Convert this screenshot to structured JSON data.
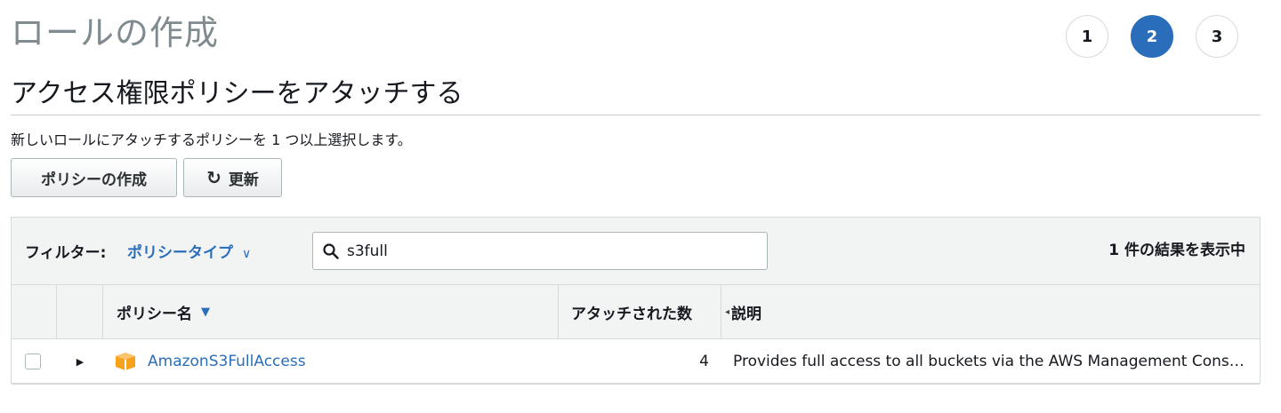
{
  "page": {
    "title": "ロールの作成",
    "steps": [
      "1",
      "2",
      "3"
    ],
    "active_step": "2"
  },
  "section": {
    "title": "アクセス権限ポリシーをアタッチする",
    "description": "新しいロールにアタッチするポリシーを 1 つ以上選択します。"
  },
  "toolbar": {
    "create_policy_label": "ポリシーの作成",
    "refresh_label": "更新",
    "refresh_icon": "refresh-icon"
  },
  "filter": {
    "label": "フィルター:",
    "type_value": "ポリシータイプ",
    "search_value": "s3full",
    "result_count": "1 件の結果を表示中"
  },
  "table": {
    "columns": {
      "name": "ポリシー名",
      "attached": "アタッチされた数",
      "description": "説明"
    },
    "rows": [
      {
        "name": "AmazonS3FullAccess",
        "attached_count": "4",
        "description": "Provides full access to all buckets via the AWS Management Console.",
        "icon": "aws-managed-policy-icon",
        "selected": false
      }
    ]
  },
  "colors": {
    "accent": "#2a6ebb",
    "policy_icon": "#f7a21c"
  }
}
